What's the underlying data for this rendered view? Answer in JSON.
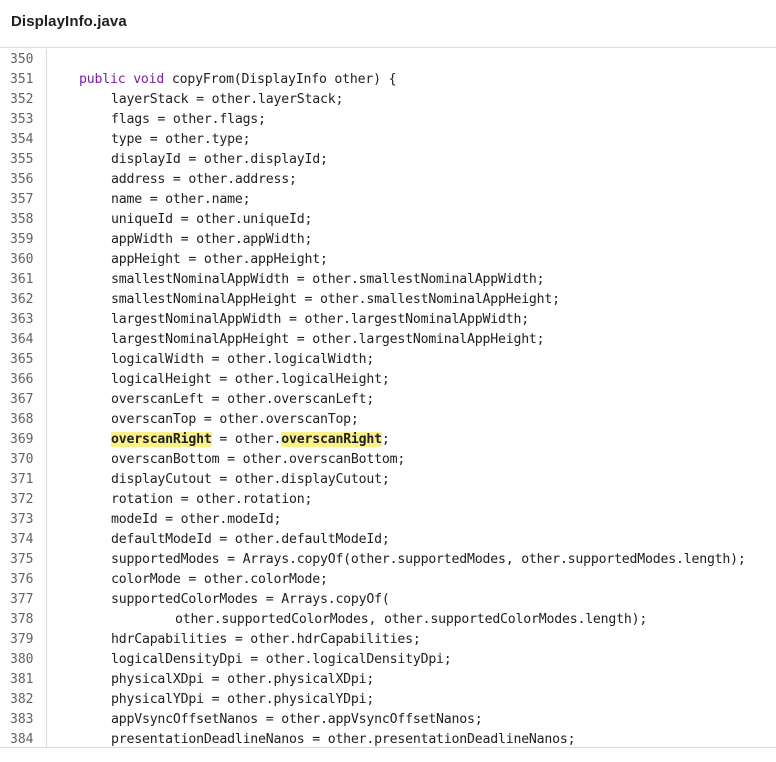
{
  "header": {
    "file_name": "DisplayInfo.java"
  },
  "code": {
    "lines": [
      {
        "n": "350",
        "indent": "",
        "parts": []
      },
      {
        "n": "351",
        "indent": "    ",
        "parts": [
          {
            "t": "public",
            "k": "kw"
          },
          {
            "t": " "
          },
          {
            "t": "void",
            "k": "kw"
          },
          {
            "t": " copyFrom(DisplayInfo other) {"
          }
        ]
      },
      {
        "n": "352",
        "indent": "        ",
        "parts": [
          {
            "t": "layerStack = other.layerStack;"
          }
        ]
      },
      {
        "n": "353",
        "indent": "        ",
        "parts": [
          {
            "t": "flags = other.flags;"
          }
        ]
      },
      {
        "n": "354",
        "indent": "        ",
        "parts": [
          {
            "t": "type = other.type;"
          }
        ]
      },
      {
        "n": "355",
        "indent": "        ",
        "parts": [
          {
            "t": "displayId = other.displayId;"
          }
        ]
      },
      {
        "n": "356",
        "indent": "        ",
        "parts": [
          {
            "t": "address = other.address;"
          }
        ]
      },
      {
        "n": "357",
        "indent": "        ",
        "parts": [
          {
            "t": "name = other.name;"
          }
        ]
      },
      {
        "n": "358",
        "indent": "        ",
        "parts": [
          {
            "t": "uniqueId = other.uniqueId;"
          }
        ]
      },
      {
        "n": "359",
        "indent": "        ",
        "parts": [
          {
            "t": "appWidth = other.appWidth;"
          }
        ]
      },
      {
        "n": "360",
        "indent": "        ",
        "parts": [
          {
            "t": "appHeight = other.appHeight;"
          }
        ]
      },
      {
        "n": "361",
        "indent": "        ",
        "parts": [
          {
            "t": "smallestNominalAppWidth = other.smallestNominalAppWidth;"
          }
        ]
      },
      {
        "n": "362",
        "indent": "        ",
        "parts": [
          {
            "t": "smallestNominalAppHeight = other.smallestNominalAppHeight;"
          }
        ]
      },
      {
        "n": "363",
        "indent": "        ",
        "parts": [
          {
            "t": "largestNominalAppWidth = other.largestNominalAppWidth;"
          }
        ]
      },
      {
        "n": "364",
        "indent": "        ",
        "parts": [
          {
            "t": "largestNominalAppHeight = other.largestNominalAppHeight;"
          }
        ]
      },
      {
        "n": "365",
        "indent": "        ",
        "parts": [
          {
            "t": "logicalWidth = other.logicalWidth;"
          }
        ]
      },
      {
        "n": "366",
        "indent": "        ",
        "parts": [
          {
            "t": "logicalHeight = other.logicalHeight;"
          }
        ]
      },
      {
        "n": "367",
        "indent": "        ",
        "parts": [
          {
            "t": "overscanLeft = other.overscanLeft;"
          }
        ]
      },
      {
        "n": "368",
        "indent": "        ",
        "parts": [
          {
            "t": "overscanTop = other.overscanTop;"
          }
        ]
      },
      {
        "n": "369",
        "indent": "        ",
        "parts": [
          {
            "t": "overscanRight",
            "k": "hl"
          },
          {
            "t": " = other."
          },
          {
            "t": "overscanRight",
            "k": "hl"
          },
          {
            "t": ";"
          }
        ]
      },
      {
        "n": "370",
        "indent": "        ",
        "parts": [
          {
            "t": "overscanBottom = other.overscanBottom;"
          }
        ]
      },
      {
        "n": "371",
        "indent": "        ",
        "parts": [
          {
            "t": "displayCutout = other.displayCutout;"
          }
        ]
      },
      {
        "n": "372",
        "indent": "        ",
        "parts": [
          {
            "t": "rotation = other.rotation;"
          }
        ]
      },
      {
        "n": "373",
        "indent": "        ",
        "parts": [
          {
            "t": "modeId = other.modeId;"
          }
        ]
      },
      {
        "n": "374",
        "indent": "        ",
        "parts": [
          {
            "t": "defaultModeId = other.defaultModeId;"
          }
        ]
      },
      {
        "n": "375",
        "indent": "        ",
        "parts": [
          {
            "t": "supportedModes = Arrays.copyOf(other.supportedModes, other.supportedModes.length);"
          }
        ]
      },
      {
        "n": "376",
        "indent": "        ",
        "parts": [
          {
            "t": "colorMode = other.colorMode;"
          }
        ]
      },
      {
        "n": "377",
        "indent": "        ",
        "parts": [
          {
            "t": "supportedColorModes = Arrays.copyOf("
          }
        ]
      },
      {
        "n": "378",
        "indent": "                ",
        "parts": [
          {
            "t": "other.supportedColorModes, other.supportedColorModes.length);"
          }
        ]
      },
      {
        "n": "379",
        "indent": "        ",
        "parts": [
          {
            "t": "hdrCapabilities = other.hdrCapabilities;"
          }
        ]
      },
      {
        "n": "380",
        "indent": "        ",
        "parts": [
          {
            "t": "logicalDensityDpi = other.logicalDensityDpi;"
          }
        ]
      },
      {
        "n": "381",
        "indent": "        ",
        "parts": [
          {
            "t": "physicalXDpi = other.physicalXDpi;"
          }
        ]
      },
      {
        "n": "382",
        "indent": "        ",
        "parts": [
          {
            "t": "physicalYDpi = other.physicalYDpi;"
          }
        ]
      },
      {
        "n": "383",
        "indent": "        ",
        "parts": [
          {
            "t": "appVsyncOffsetNanos = other.appVsyncOffsetNanos;"
          }
        ]
      },
      {
        "n": "384",
        "indent": "        ",
        "parts": [
          {
            "t": "presentationDeadlineNanos = other.presentationDeadlineNanos;"
          }
        ]
      }
    ]
  },
  "colors": {
    "keyword": "#7b1fa2",
    "highlight": "#fbf188",
    "line_number": "#5f6368",
    "border": "#dadce0"
  }
}
